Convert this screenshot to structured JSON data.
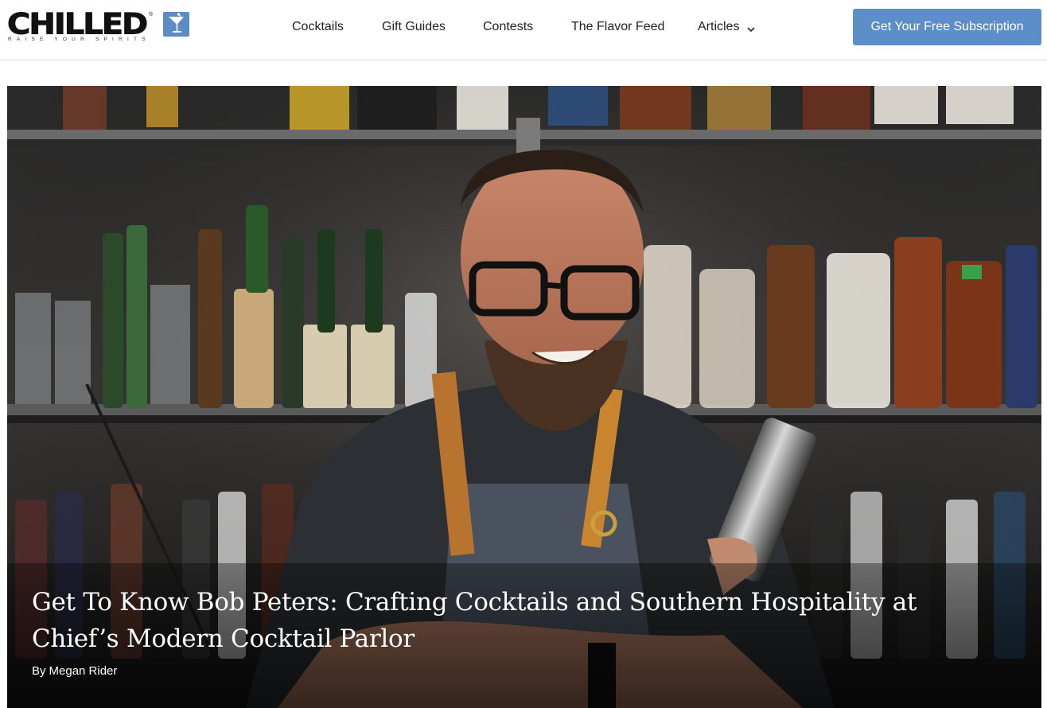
{
  "brand": {
    "name": "CHILLED",
    "tagline": "RAISE YOUR SPIRITS",
    "icon": "martini-glass-icon",
    "accent": "#5d8cc5"
  },
  "nav": {
    "items": [
      {
        "label": "Cocktails"
      },
      {
        "label": "Gift Guides"
      },
      {
        "label": "Contests"
      },
      {
        "label": "The Flavor Feed"
      },
      {
        "label": "Articles",
        "icon": "chevron-down-icon"
      }
    ],
    "cta_label": "Get Your Free Subscription",
    "cta_color": "#5c8ec7"
  },
  "hero": {
    "title": "Get To Know Bob Peters: Crafting Cocktails and Southern Hospitality at Chief’s Modern Cocktail Parlor",
    "byline_prefix": "By",
    "author": "Megan Rider",
    "image_subject": "bartender-portrait"
  }
}
